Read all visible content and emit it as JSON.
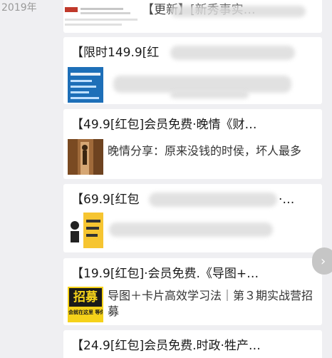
{
  "header": {
    "year": "2019年"
  },
  "feed": {
    "cards": [
      {
        "title": "【更新】[新秀事实…",
        "thumb_title": "",
        "description": ""
      },
      {
        "title": "【限时149.9[红",
        "description": ""
      },
      {
        "title": "【49.9[红包]会员免费·晚情《财…",
        "description": "晚情分享：原来没钱的时侯，坏人最多"
      },
      {
        "title": "【69.9[红包",
        "title_tail": "·…",
        "description": ""
      },
      {
        "title": "【19.9[红包]·会员免费.《导图+…",
        "description": "导图＋卡片高效学习法｜第３期实战营招募",
        "thumb_big": "招募",
        "thumb_small": "会就在这里 等你"
      },
      {
        "title": "【24.9[红包]会员免费.时政·牲产…",
        "description": ""
      }
    ]
  },
  "ui": {
    "scroll_icon": "chevron-right-icon"
  }
}
